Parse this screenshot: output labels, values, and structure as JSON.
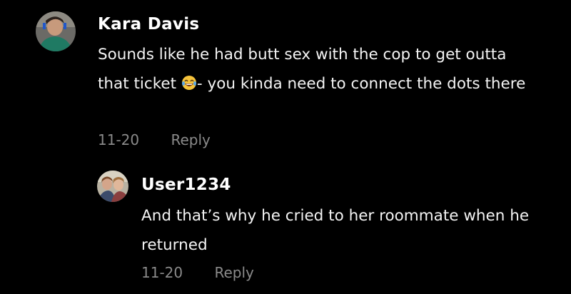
{
  "comments": [
    {
      "username": "Kara Davis",
      "text_before_emoji": "Sounds like he had butt sex with the cop to get outta that ticket ",
      "emoji": "face-with-tears-of-joy-icon",
      "text_after_emoji": "- you kinda need to connect the dots there",
      "date": "11-20",
      "reply_label": "Reply",
      "replies": [
        {
          "username": "User1234",
          "text": "And that’s why he cried to her roommate when he returned",
          "date": "11-20",
          "reply_label": "Reply"
        }
      ]
    }
  ],
  "colors": {
    "background": "#000000",
    "username": "#ffffff",
    "body_text": "#f4f4f4",
    "meta_text": "#8a8a8a"
  }
}
